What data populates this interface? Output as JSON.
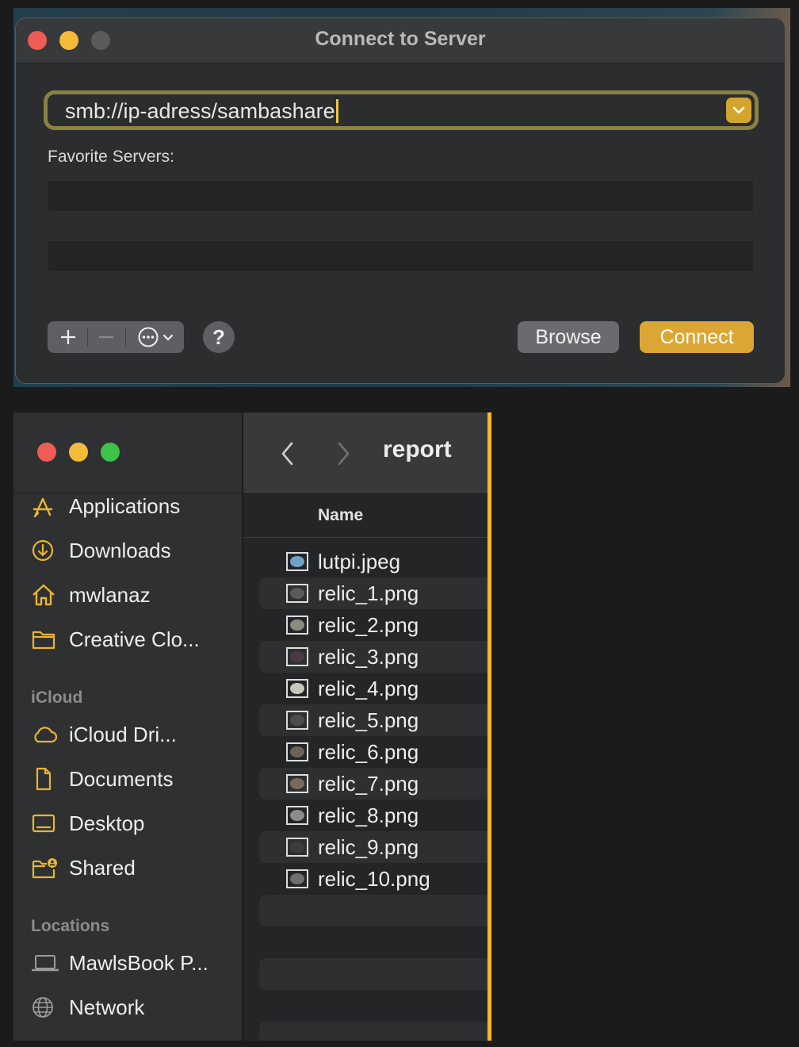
{
  "dialog": {
    "title": "Connect to Server",
    "server_address": "smb://ip-adress/sambashare",
    "favorite_label": "Favorite Servers:",
    "favorites": [],
    "help_label": "?",
    "browse_label": "Browse",
    "connect_label": "Connect",
    "add_icon": "plus-icon",
    "remove_icon": "minus-icon",
    "more_icon": "ellipsis-circle-icon",
    "accent_color": "#dba633"
  },
  "finder": {
    "folder_title": "report",
    "column_name": "Name",
    "sidebar": {
      "favorites": [
        {
          "label": "Applications",
          "icon": "applications-icon"
        },
        {
          "label": "Downloads",
          "icon": "downloads-icon"
        },
        {
          "label": "mwlanaz",
          "icon": "home-icon"
        },
        {
          "label": "Creative Clo...",
          "icon": "folder-icon"
        }
      ],
      "icloud_heading": "iCloud",
      "icloud": [
        {
          "label": "iCloud Dri...",
          "icon": "cloud-icon"
        },
        {
          "label": "Documents",
          "icon": "document-icon"
        },
        {
          "label": "Desktop",
          "icon": "desktop-icon"
        },
        {
          "label": "Shared",
          "icon": "shared-folder-icon"
        }
      ],
      "locations_heading": "Locations",
      "locations": [
        {
          "label": "MawlsBook P...",
          "icon": "laptop-icon"
        },
        {
          "label": "Network",
          "icon": "network-icon"
        }
      ]
    },
    "files": [
      "lutpi.jpeg",
      "relic_1.png",
      "relic_2.png",
      "relic_3.png",
      "relic_4.png",
      "relic_5.png",
      "relic_6.png",
      "relic_7.png",
      "relic_8.png",
      "relic_9.png",
      "relic_10.png"
    ],
    "accent_color": "#f0b92d"
  }
}
